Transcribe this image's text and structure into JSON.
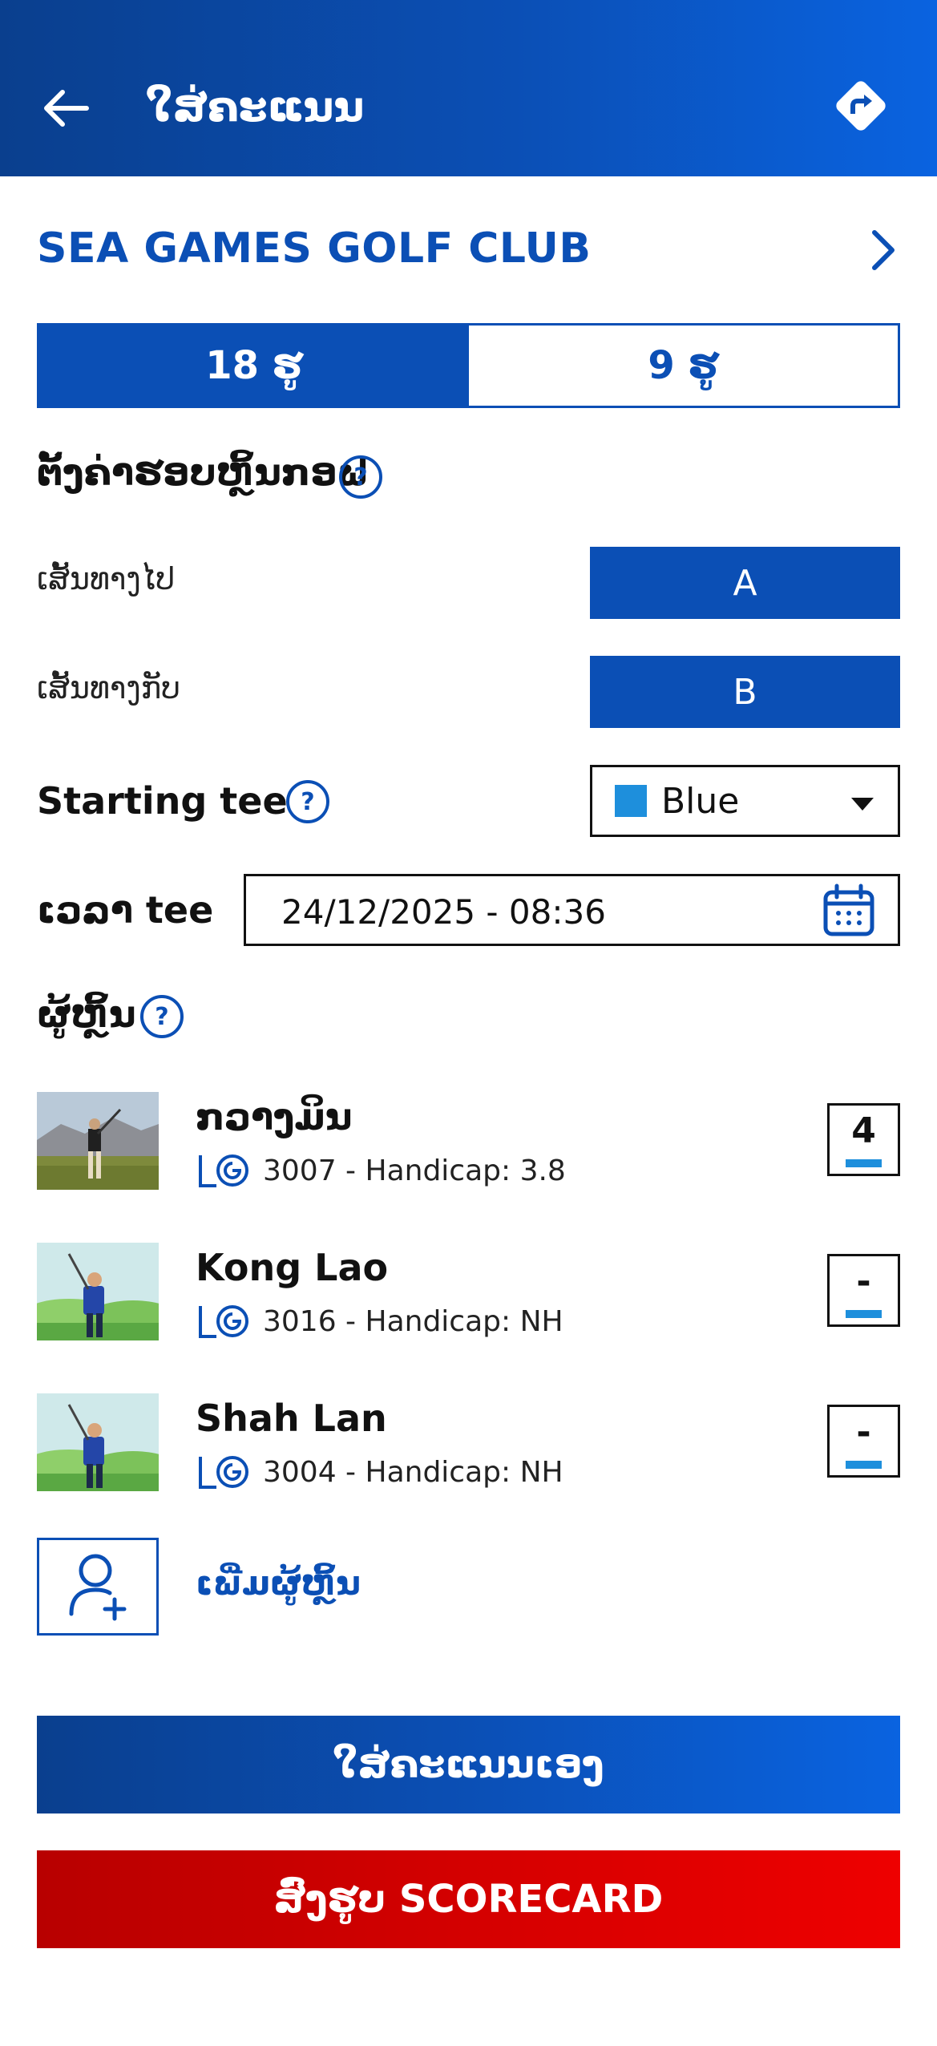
{
  "header": {
    "title": "ໃສ່ຄະແນນ",
    "back_icon": "arrow-left-icon",
    "nav_icon": "directions-icon"
  },
  "club": {
    "name": "SEA GAMES GOLF CLUB",
    "chevron_icon": "chevron-right-icon"
  },
  "holes": {
    "options": [
      "18 ຮູ",
      "9 ຮູ"
    ],
    "selected": "18 ຮູ"
  },
  "settings": {
    "title": "ຕັ້ງຄ່າຮອບຫຼິ້ນກອຟ",
    "route_out_label": "ເສັ້ນທາງໄປ",
    "route_out_value": "A",
    "route_back_label": "ເສັ້ນທາງກັບ",
    "route_back_value": "B",
    "starting_tee_label": "Starting tee",
    "starting_tee_value": "Blue",
    "starting_tee_color": "#1e8fdc",
    "tee_time_label": "ເວລາ tee",
    "tee_time_value": "24/12/2025 - 08:36"
  },
  "players": {
    "title": "ຜູ້ຫຼິ້ນ",
    "list": [
      {
        "name": "ກວາງມິນ",
        "info": "3007 - Handicap: 3.8",
        "score": "4"
      },
      {
        "name": "Kong Lao",
        "info": "3016 - Handicap: NH",
        "score": "-"
      },
      {
        "name": "Shah Lan",
        "info": "3004 - Handicap: NH",
        "score": "-"
      }
    ],
    "add_label": "ເພີ່ມຜູ້ຫຼິ້ນ"
  },
  "actions": {
    "primary": "ໃສ່ຄະແນນເອງ",
    "scan": "ສົ່ງຮູບ SCORECARD"
  },
  "colors": {
    "brand_blue": "#0b4fb5",
    "accent_red": "#d40000",
    "tee_blue": "#1e8fdc"
  }
}
